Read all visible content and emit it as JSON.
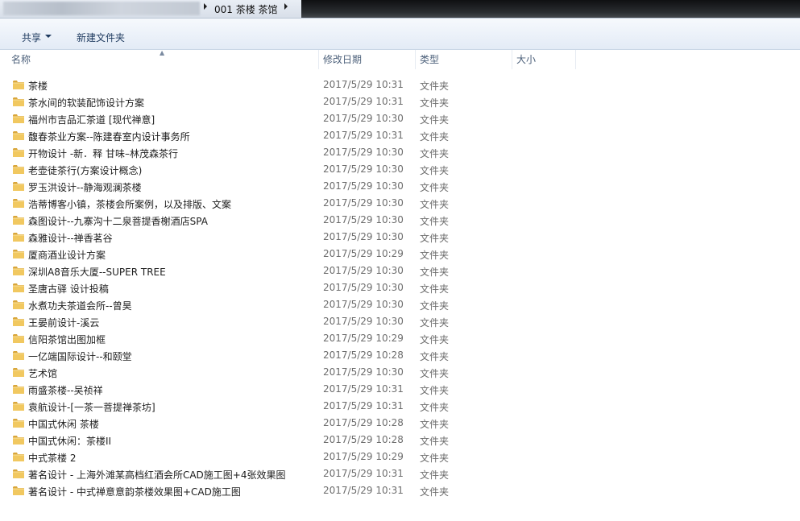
{
  "address_bar": {
    "crumb": "001 茶楼 茶馆"
  },
  "toolbar": {
    "share_label": "共享",
    "new_folder_label": "新建文件夹"
  },
  "columns": {
    "name": "名称",
    "date": "修改日期",
    "type": "类型",
    "size": "大小"
  },
  "files": [
    {
      "name": "茶楼",
      "date": "2017/5/29 10:31",
      "type": "文件夹"
    },
    {
      "name": "茶水间的软装配饰设计方案",
      "date": "2017/5/29 10:31",
      "type": "文件夹"
    },
    {
      "name": "福州市吉品汇茶道 [现代禅意]",
      "date": "2017/5/29 10:30",
      "type": "文件夹"
    },
    {
      "name": "馥春茶业方案--陈建春室内设计事务所",
      "date": "2017/5/29 10:31",
      "type": "文件夹"
    },
    {
      "name": "开物设计 -新．释 甘味–林茂森茶行",
      "date": "2017/5/29 10:30",
      "type": "文件夹"
    },
    {
      "name": "老壶徒茶行(方案设计概念)",
      "date": "2017/5/29 10:30",
      "type": "文件夹"
    },
    {
      "name": "罗玉洪设计--静海观澜茶楼",
      "date": "2017/5/29 10:30",
      "type": "文件夹"
    },
    {
      "name": "浩蒂博客小镇，茶楼会所案例，以及排版、文案",
      "date": "2017/5/29 10:30",
      "type": "文件夹"
    },
    {
      "name": "森图设计--九寨沟十二泉菩提香榭酒店SPA",
      "date": "2017/5/29 10:30",
      "type": "文件夹"
    },
    {
      "name": "森雅设计--禅香茗谷",
      "date": "2017/5/29 10:30",
      "type": "文件夹"
    },
    {
      "name": "厦商酒业设计方案",
      "date": "2017/5/29 10:29",
      "type": "文件夹"
    },
    {
      "name": "深圳A8音乐大厦--SUPER TREE",
      "date": "2017/5/29 10:30",
      "type": "文件夹"
    },
    {
      "name": "圣唐古驿 设计投稿",
      "date": "2017/5/29 10:30",
      "type": "文件夹"
    },
    {
      "name": "水煮功夫茶道会所--曾昊",
      "date": "2017/5/29 10:30",
      "type": "文件夹"
    },
    {
      "name": "王晏前设计-溪云",
      "date": "2017/5/29 10:30",
      "type": "文件夹"
    },
    {
      "name": "信阳茶馆出图加框",
      "date": "2017/5/29 10:29",
      "type": "文件夹"
    },
    {
      "name": "一亿端国际设计--和颐堂",
      "date": "2017/5/29 10:28",
      "type": "文件夹"
    },
    {
      "name": "艺术馆",
      "date": "2017/5/29 10:30",
      "type": "文件夹"
    },
    {
      "name": "雨盛茶楼--吴祯祥",
      "date": "2017/5/29 10:31",
      "type": "文件夹"
    },
    {
      "name": "袁航设计-[一茶一菩提禅茶坊]",
      "date": "2017/5/29 10:31",
      "type": "文件夹"
    },
    {
      "name": "中国式休闲 茶楼",
      "date": "2017/5/29 10:28",
      "type": "文件夹"
    },
    {
      "name": "中国式休闲：茶楼II",
      "date": "2017/5/29 10:28",
      "type": "文件夹"
    },
    {
      "name": "中式茶楼 2",
      "date": "2017/5/29 10:29",
      "type": "文件夹"
    },
    {
      "name": "著名设计 - 上海外滩某高档红酒会所CAD施工图+4张效果图",
      "date": "2017/5/29 10:31",
      "type": "文件夹"
    },
    {
      "name": "著名设计 - 中式禅意意韵茶楼效果图+CAD施工图",
      "date": "2017/5/29 10:31",
      "type": "文件夹"
    }
  ],
  "icons": {
    "folder": "folder-icon",
    "separator": "chevron-right-icon",
    "dropdown": "chevron-down-icon",
    "sort": "sort-up-icon"
  },
  "colors": {
    "folder": "#e8b84a",
    "toolbar_text": "#1e3a5f",
    "header_text": "#4c607a",
    "meta_text": "#6d6d6d"
  }
}
